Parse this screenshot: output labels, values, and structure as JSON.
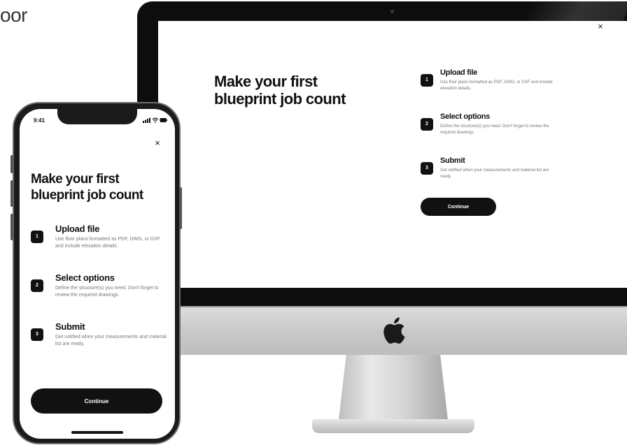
{
  "cutoff_text": "oor",
  "desktop": {
    "close_label": "×",
    "heading": "Make your first blueprint job count",
    "steps": [
      {
        "number": "1",
        "title": "Upload file",
        "description": "Use floor plans formatted as PDF, DWG, or DXF and include elevation details."
      },
      {
        "number": "2",
        "title": "Select options",
        "description": "Define the structure(s) you need. Don't forget to review the required drawings."
      },
      {
        "number": "3",
        "title": "Submit",
        "description": "Get notified when your measurements and material list are ready."
      }
    ],
    "continue_label": "Continue"
  },
  "mobile": {
    "status_time": "9:41",
    "close_label": "×",
    "heading": "Make your first blueprint job count",
    "steps": [
      {
        "number": "1",
        "title": "Upload file",
        "description": "Use floor plans formatted as PDF, DWG, or DXF and include elevation details."
      },
      {
        "number": "2",
        "title": "Select options",
        "description": "Define the structure(s) you need. Don't forget to review the required drawings."
      },
      {
        "number": "3",
        "title": "Submit",
        "description": "Get notified when your measurements and material list are ready."
      }
    ],
    "continue_label": "Continue"
  }
}
